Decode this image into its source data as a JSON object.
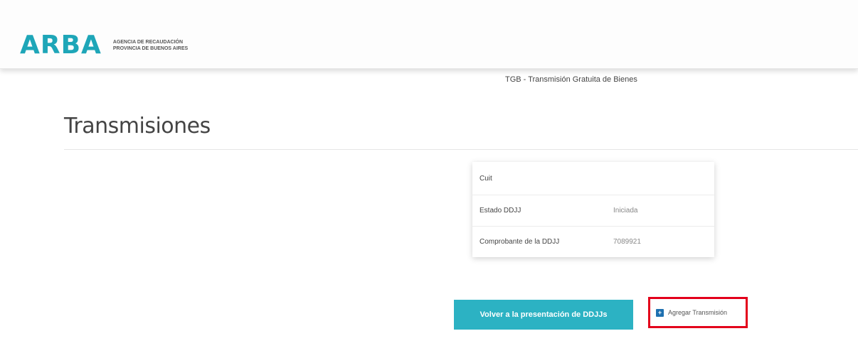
{
  "header": {
    "logo_text": "ARBA",
    "agency_line1": "AGENCIA DE RECAUDACIÓN",
    "agency_line2": "PROVINCIA DE BUENOS AIRES"
  },
  "subtitle": "TGB - Transmisión Gratuita de Bienes",
  "page_title": "Transmisiones",
  "info_card": {
    "rows": [
      {
        "label": "Cuit",
        "value": ""
      },
      {
        "label": "Estado DDJJ",
        "value": "Iniciada"
      },
      {
        "label": "Comprobante de la DDJJ",
        "value": "7089921"
      }
    ]
  },
  "actions": {
    "back_label": "Volver a la presentación de DDJJs",
    "add_label": "Agregar Transmisión",
    "add_icon": "plus-square-icon",
    "highlight_color": "#e3001b"
  }
}
